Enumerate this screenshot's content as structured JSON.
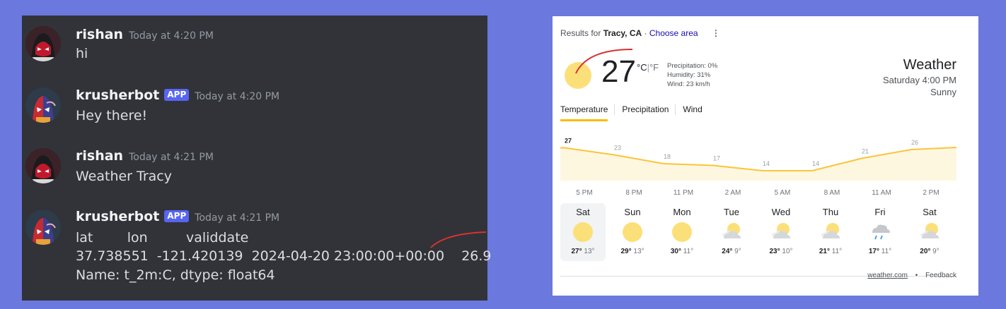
{
  "discord": {
    "messages": [
      {
        "username": "rishan",
        "timestamp": "Today at 4:20 PM",
        "lines": [
          "hi"
        ],
        "app": false
      },
      {
        "username": "krusherbot",
        "badge": "APP",
        "timestamp": "Today at 4:20 PM",
        "lines": [
          "Hey there!"
        ],
        "app": true
      },
      {
        "username": "rishan",
        "timestamp": "Today at 4:21 PM",
        "lines": [
          "Weather Tracy"
        ],
        "app": false
      },
      {
        "username": "krusherbot",
        "badge": "APP",
        "timestamp": "Today at 4:21 PM",
        "lines": [
          "lat        lon         validdate",
          "37.738551  -121.420139  2024-04-20 23:00:00+00:00    26.9",
          "Name: t_2m:C, dtype: float64"
        ],
        "app": true
      }
    ]
  },
  "weather": {
    "results_prefix": "Results for",
    "location": "Tracy, CA",
    "dot": "·",
    "choose_area": "Choose area",
    "kebab": "⋮",
    "current_temp": "27",
    "unit_c": "°C",
    "unit_sep": "|",
    "unit_f": "°F",
    "precipitation": "Precipitation: 0%",
    "humidity": "Humidity: 31%",
    "wind": "Wind: 23 km/h",
    "title": "Weather",
    "datetime": "Saturday 4:00 PM",
    "condition": "Sunny",
    "tabs": [
      "Temperature",
      "Precipitation",
      "Wind"
    ],
    "footer_link": "weather.com",
    "footer_dot": "•",
    "feedback": "Feedback",
    "days": [
      {
        "name": "Sat",
        "icon": "sun-icon",
        "hi": "27°",
        "lo": "13°"
      },
      {
        "name": "Sun",
        "icon": "sun-icon",
        "hi": "29°",
        "lo": "13°"
      },
      {
        "name": "Mon",
        "icon": "sun-icon",
        "hi": "30°",
        "lo": "11°"
      },
      {
        "name": "Tue",
        "icon": "partly-cloudy-icon",
        "hi": "24°",
        "lo": "9°"
      },
      {
        "name": "Wed",
        "icon": "partly-cloudy-icon",
        "hi": "23°",
        "lo": "10°"
      },
      {
        "name": "Thu",
        "icon": "partly-cloudy-icon",
        "hi": "21°",
        "lo": "11°"
      },
      {
        "name": "Fri",
        "icon": "rain-icon",
        "hi": "17°",
        "lo": "11°"
      },
      {
        "name": "Sat",
        "icon": "partly-cloudy-icon",
        "hi": "20°",
        "lo": "9°"
      }
    ],
    "colors": {
      "accent": "#fbbc04",
      "sun": "#fbe07a",
      "area_fill": "#fef7e0",
      "line": "#fbc43a"
    }
  },
  "chart_data": {
    "type": "area",
    "categories": [
      "5 PM",
      "8 PM",
      "11 PM",
      "2 AM",
      "5 AM",
      "8 AM",
      "11 AM",
      "2 PM"
    ],
    "values": [
      27,
      23,
      18,
      17,
      14,
      14,
      21,
      26
    ],
    "ylim": [
      10,
      30
    ],
    "grid": false
  }
}
